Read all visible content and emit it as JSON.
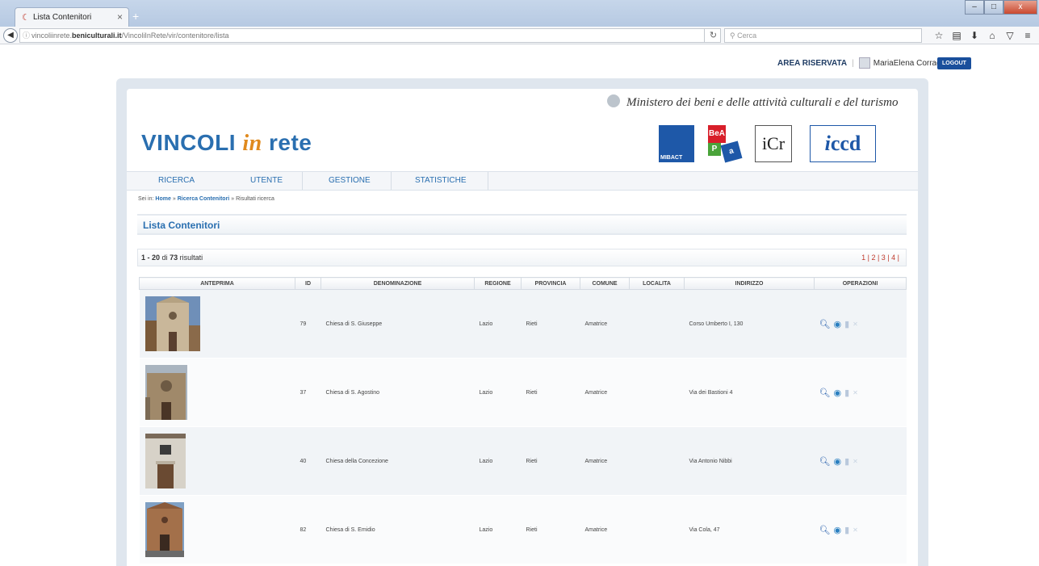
{
  "browser": {
    "tab_title": "Lista Contenitori",
    "tab_close": "×",
    "new_tab": "+",
    "url_prefix": "vincoliinrete.",
    "url_domain": "beniculturali.it",
    "url_path": "/VincoliInRete/vir/contenitore/lista",
    "search_placeholder": "Cerca",
    "win_min": "–",
    "win_max": "□",
    "win_close": "x"
  },
  "header": {
    "area_riservata": "AREA RISERVATA",
    "user_name": "MariaElena Corrado",
    "logout": "LOGOUT",
    "ministero": "Ministero dei beni e delle attività culturali e del turismo",
    "logo_vincoli": "VINCOLI",
    "logo_in": "in",
    "logo_rete": "rete",
    "partner_mibact": "MIBACT",
    "partner_bea_a": "BeA",
    "partner_bea_b": "P",
    "partner_bea_c": "a",
    "partner_icr": "iCr",
    "partner_iccd_i": "i",
    "partner_iccd": "ccd"
  },
  "nav": {
    "items": [
      "RICERCA",
      "UTENTE",
      "GESTIONE",
      "STATISTICHE"
    ]
  },
  "breadcrumb": {
    "prefix": "Sei in:",
    "home": "Home",
    "sep": "»",
    "ricerca": "Ricerca Contenitori",
    "current": "Risultati ricerca"
  },
  "page_title": "Lista Contenitori",
  "results": {
    "range": "1 - 20",
    "di": "di",
    "total": "73",
    "label": "risultati",
    "pagination": "1 | 2 | 3 | 4 |"
  },
  "table": {
    "columns": [
      "ANTEPRIMA",
      "ID",
      "DENOMINAZIONE",
      "REGIONE",
      "PROVINCIA",
      "COMUNE",
      "LOCALITA",
      "INDIRIZZO",
      "OPERAZIONI"
    ],
    "rows": [
      {
        "id": "79",
        "denominazione": "Chiesa di S. Giuseppe",
        "regione": "Lazio",
        "provincia": "Rieti",
        "comune": "Amatrice",
        "localita": "",
        "indirizzo": "Corso Umberto I, 130"
      },
      {
        "id": "37",
        "denominazione": "Chiesa di S. Agostino",
        "regione": "Lazio",
        "provincia": "Rieti",
        "comune": "Amatrice",
        "localita": "",
        "indirizzo": "Via dei Bastioni 4"
      },
      {
        "id": "40",
        "denominazione": "Chiesa della Concezione",
        "regione": "Lazio",
        "provincia": "Rieti",
        "comune": "Amatrice",
        "localita": "",
        "indirizzo": "Via Antonio Nibbi"
      },
      {
        "id": "82",
        "denominazione": "Chiesa di S. Emidio",
        "regione": "Lazio",
        "provincia": "Rieti",
        "comune": "Amatrice",
        "localita": "",
        "indirizzo": "Via Cola, 47"
      }
    ]
  },
  "icons": {
    "search": "search-icon",
    "globe": "globe-icon",
    "document": "document-icon",
    "delete": "delete-icon"
  }
}
